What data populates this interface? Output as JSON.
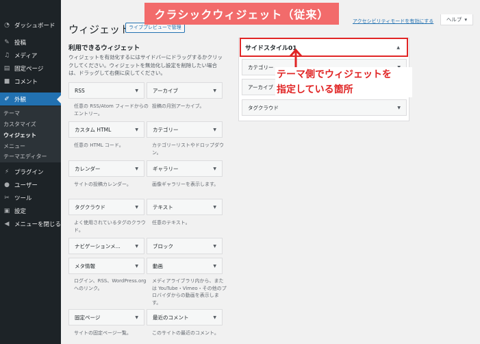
{
  "banner": {
    "title": "クラシックウィジェット（従来）"
  },
  "admin_menu": {
    "items": [
      {
        "label": "ダッシュボード",
        "icon": "dashboard-icon"
      },
      {
        "label": "投稿",
        "icon": "pin-icon"
      },
      {
        "label": "メディア",
        "icon": "media-icon"
      },
      {
        "label": "固定ページ",
        "icon": "page-icon"
      },
      {
        "label": "コメント",
        "icon": "comment-icon"
      },
      {
        "label": "外観",
        "icon": "paintbrush-icon",
        "active": true
      },
      {
        "label": "プラグイン",
        "icon": "plugin-icon"
      },
      {
        "label": "ユーザー",
        "icon": "user-icon"
      },
      {
        "label": "ツール",
        "icon": "wrench-icon"
      },
      {
        "label": "設定",
        "icon": "settings-icon"
      },
      {
        "label": "メニューを閉じる",
        "icon": "collapse-icon"
      }
    ],
    "submenu": [
      {
        "label": "テーマ"
      },
      {
        "label": "カスタマイズ"
      },
      {
        "label": "ウィジェット",
        "current": true
      },
      {
        "label": "メニュー"
      },
      {
        "label": "テーマエディター"
      }
    ]
  },
  "header": {
    "title": "ウィジェット",
    "preview_button": "ライブプレビューで管理",
    "a11y_link": "アクセシビリティモードを有効にする",
    "help_button": "ヘルプ"
  },
  "available": {
    "heading": "利用できるウィジェット",
    "description": "ウィジェットを有効化するにはサイドバーにドラッグするかクリックしてください。ウィジェットを無効化し設定を削除したい場合は、ドラッグして右側に戻してください。",
    "widgets": [
      {
        "title": "RSS",
        "desc": "任意の RSS/Atom フィードからのエントリー。"
      },
      {
        "title": "アーカイブ",
        "desc": "投稿の月別アーカイブ。"
      },
      {
        "title": "カスタム HTML",
        "desc": "任意の HTML コード。"
      },
      {
        "title": "カテゴリー",
        "desc": "カテゴリーリストやドロップダウン。"
      },
      {
        "title": "カレンダー",
        "desc": "サイトの投稿カレンダー。"
      },
      {
        "title": "ギャラリー",
        "desc": "画像ギャラリーを表示します。"
      },
      {
        "title": "タグクラウド",
        "desc": "よく使用されているタグのクラウド。"
      },
      {
        "title": "テキスト",
        "desc": "任意のテキスト。"
      },
      {
        "title": "ナビゲーションメ...",
        "desc": ""
      },
      {
        "title": "ブロック",
        "desc": ""
      },
      {
        "title": "メタ情報",
        "desc": "ログイン、RSS、WordPress.org へのリンク。"
      },
      {
        "title": "動画",
        "desc": "メディアライブラリ内から、または YouTube・Vimeo・その他のプロバイダからの動画を表示します。"
      },
      {
        "title": "固定ページ",
        "desc": "サイトの固定ページ一覧。"
      },
      {
        "title": "最近のコメント",
        "desc": "このサイトの最近のコメント。"
      }
    ]
  },
  "sidebar_area": {
    "title": "サイドスタイル01",
    "widgets": [
      {
        "title": "カテゴリー"
      },
      {
        "title": "アーカイブ"
      },
      {
        "title": "タグクラウド"
      }
    ]
  },
  "annotation": {
    "line1": "テーマ側でウィジェットを",
    "line2": "指定している箇所",
    "color": "#e02424"
  }
}
